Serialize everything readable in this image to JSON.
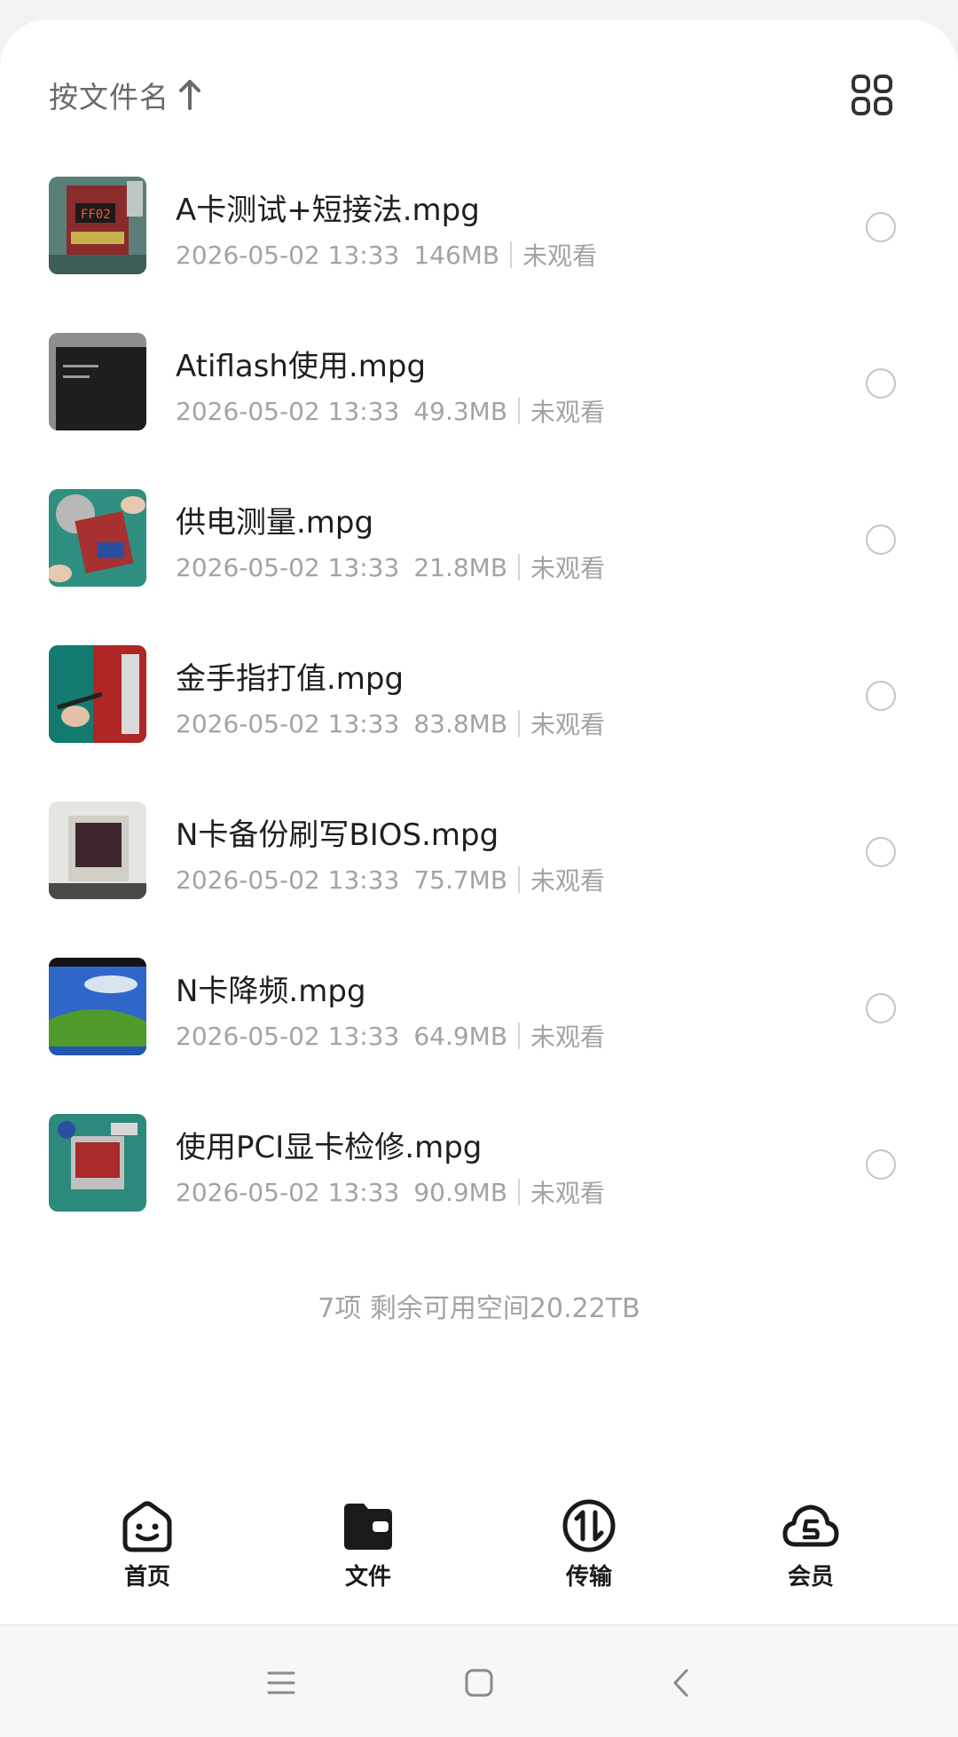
{
  "sort": {
    "label": "按文件名",
    "direction_icon": "arrow-up-icon"
  },
  "view_toggle": {
    "icon": "grid-view-icon"
  },
  "files": [
    {
      "name": "A卡测试+短接法.mpg",
      "date": "2026-05-02 13:33",
      "size": "146MB",
      "status": "未观看",
      "thumb": "circuit-board-red"
    },
    {
      "name": "Atiflash使用.mpg",
      "date": "2026-05-02 13:33",
      "size": "49.3MB",
      "status": "未观看",
      "thumb": "dark-terminal"
    },
    {
      "name": "供电测量.mpg",
      "date": "2026-05-02 13:33",
      "size": "21.8MB",
      "status": "未观看",
      "thumb": "graphics-card-hands"
    },
    {
      "name": "金手指打值.mpg",
      "date": "2026-05-02 13:33",
      "size": "83.8MB",
      "status": "未观看",
      "thumb": "red-card-probe"
    },
    {
      "name": "N卡备份刷写BIOS.mpg",
      "date": "2026-05-02 13:33",
      "size": "75.7MB",
      "status": "未观看",
      "thumb": "crt-monitor"
    },
    {
      "name": "N卡降频.mpg",
      "date": "2026-05-02 13:33",
      "size": "64.9MB",
      "status": "未观看",
      "thumb": "windows-desktop"
    },
    {
      "name": "使用PCI显卡检修.mpg",
      "date": "2026-05-02 13:33",
      "size": "90.9MB",
      "status": "未观看",
      "thumb": "workbench-card"
    }
  ],
  "summary": "7项 剩余可用空间20.22TB",
  "tabs": [
    {
      "label": "首页",
      "icon": "home-face-icon"
    },
    {
      "label": "文件",
      "icon": "folder-icon"
    },
    {
      "label": "传输",
      "icon": "transfer-icon"
    },
    {
      "label": "会员",
      "icon": "cloud-member-icon"
    }
  ],
  "system_nav": [
    "menu-icon",
    "home-square-icon",
    "back-icon"
  ],
  "colors": {
    "text_primary": "#1f1f1f",
    "text_secondary": "#a3a3a3",
    "background": "#ffffff"
  }
}
